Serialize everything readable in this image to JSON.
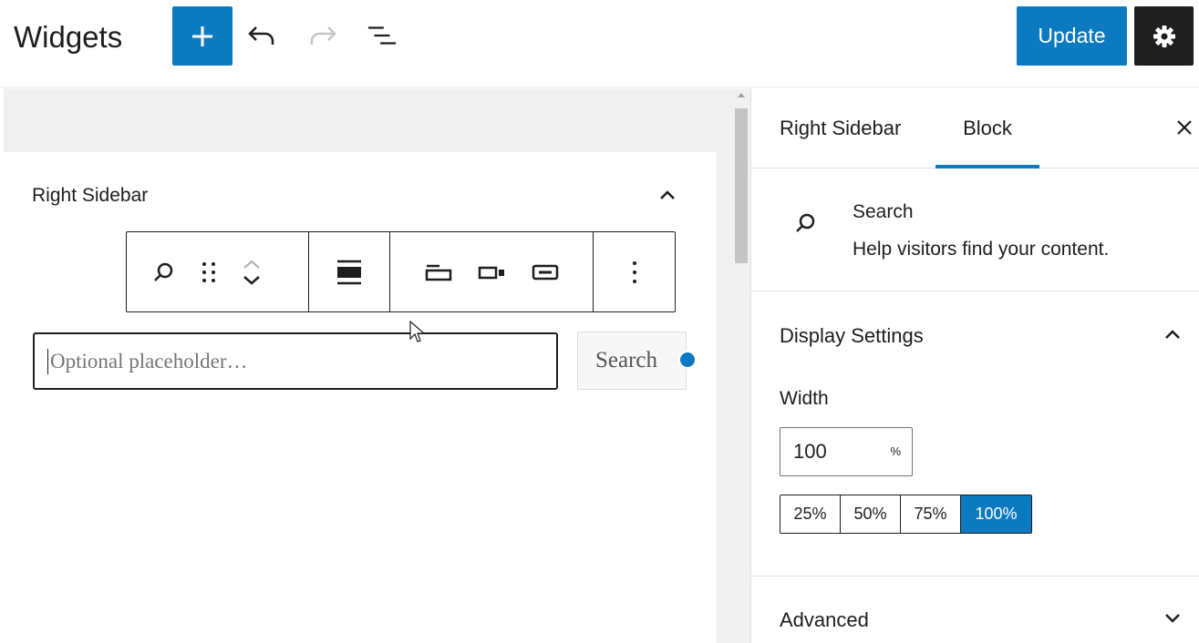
{
  "header": {
    "title": "Widgets",
    "update_label": "Update"
  },
  "icons": {
    "add": "plus-icon",
    "undo": "undo-icon",
    "redo": "redo-icon",
    "list_view": "list-view-icon",
    "settings": "gear-icon"
  },
  "colors": {
    "accent": "#0b7ac0",
    "dark": "#1e1e1e"
  },
  "canvas": {
    "widget_area_title": "Right Sidebar",
    "search_block": {
      "input_placeholder": "Optional placeholder…",
      "button_label": "Search"
    }
  },
  "sidebar": {
    "tabs": [
      {
        "label": "Right Sidebar",
        "active": false
      },
      {
        "label": "Block",
        "active": true
      }
    ],
    "block_card": {
      "name": "Search",
      "description": "Help visitors find your content."
    },
    "display_settings": {
      "title": "Display Settings",
      "width_label": "Width",
      "width_value": "100",
      "width_unit": "%",
      "presets": [
        "25%",
        "50%",
        "75%",
        "100%"
      ],
      "active_preset": "100%"
    },
    "advanced": {
      "title": "Advanced"
    }
  }
}
